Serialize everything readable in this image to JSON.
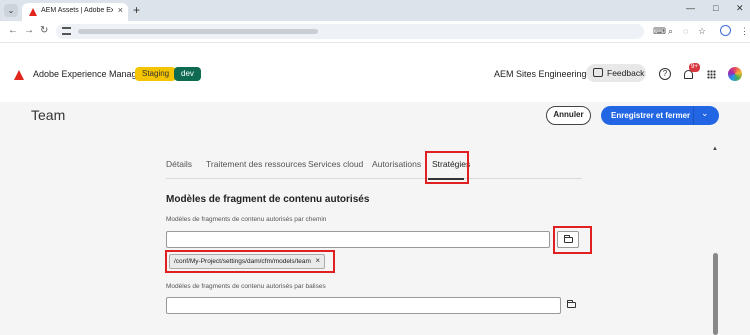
{
  "browser": {
    "tab_title": "AEM Assets | Adobe Experience",
    "tab_close": "×",
    "new_tab": "+",
    "tab_menu": "⌄",
    "window_controls": [
      "—",
      "□",
      "✕"
    ],
    "nav": {
      "back": "←",
      "forward": "→",
      "reload": "↻"
    },
    "toolbar_icons": [
      "translate-icon",
      "zoom-icon",
      "eye-off-icon",
      "star-icon",
      "profile-icon",
      "menu-icon"
    ]
  },
  "shell": {
    "product_name": "Adobe Experience Manager",
    "env_badges": [
      "Staging",
      "dev"
    ],
    "org_name": "AEM Sites Engineering",
    "feedback_label": "Feedback",
    "notification_count": "9+",
    "help_glyph": "?"
  },
  "page": {
    "title": "Team",
    "cancel_label": "Annuler",
    "save_label": "Enregistrer et fermer",
    "save_menu_glyph": "⌄",
    "tabs": [
      {
        "label": "Détails"
      },
      {
        "label": "Traitement des ressources"
      },
      {
        "label": "Services cloud"
      },
      {
        "label": "Autorisations"
      },
      {
        "label": "Stratégies"
      }
    ],
    "active_tab": "Stratégies",
    "section_title": "Modèles de fragment de contenu autorisés",
    "path_field": {
      "label": "Modèles de fragments de contenu autorisés par chemin",
      "value": "",
      "chip": "/conf/My-Project/settings/dam/cfm/models/team",
      "chip_remove": "×"
    },
    "tags_field": {
      "label": "Modèles de fragments de contenu autorisés par balises",
      "value": ""
    },
    "scroll_up_glyph": "▲"
  },
  "colors": {
    "accent": "#2266e3",
    "highlight": "#e02020",
    "staging": "#f4c400",
    "dev": "#0e6b52"
  }
}
